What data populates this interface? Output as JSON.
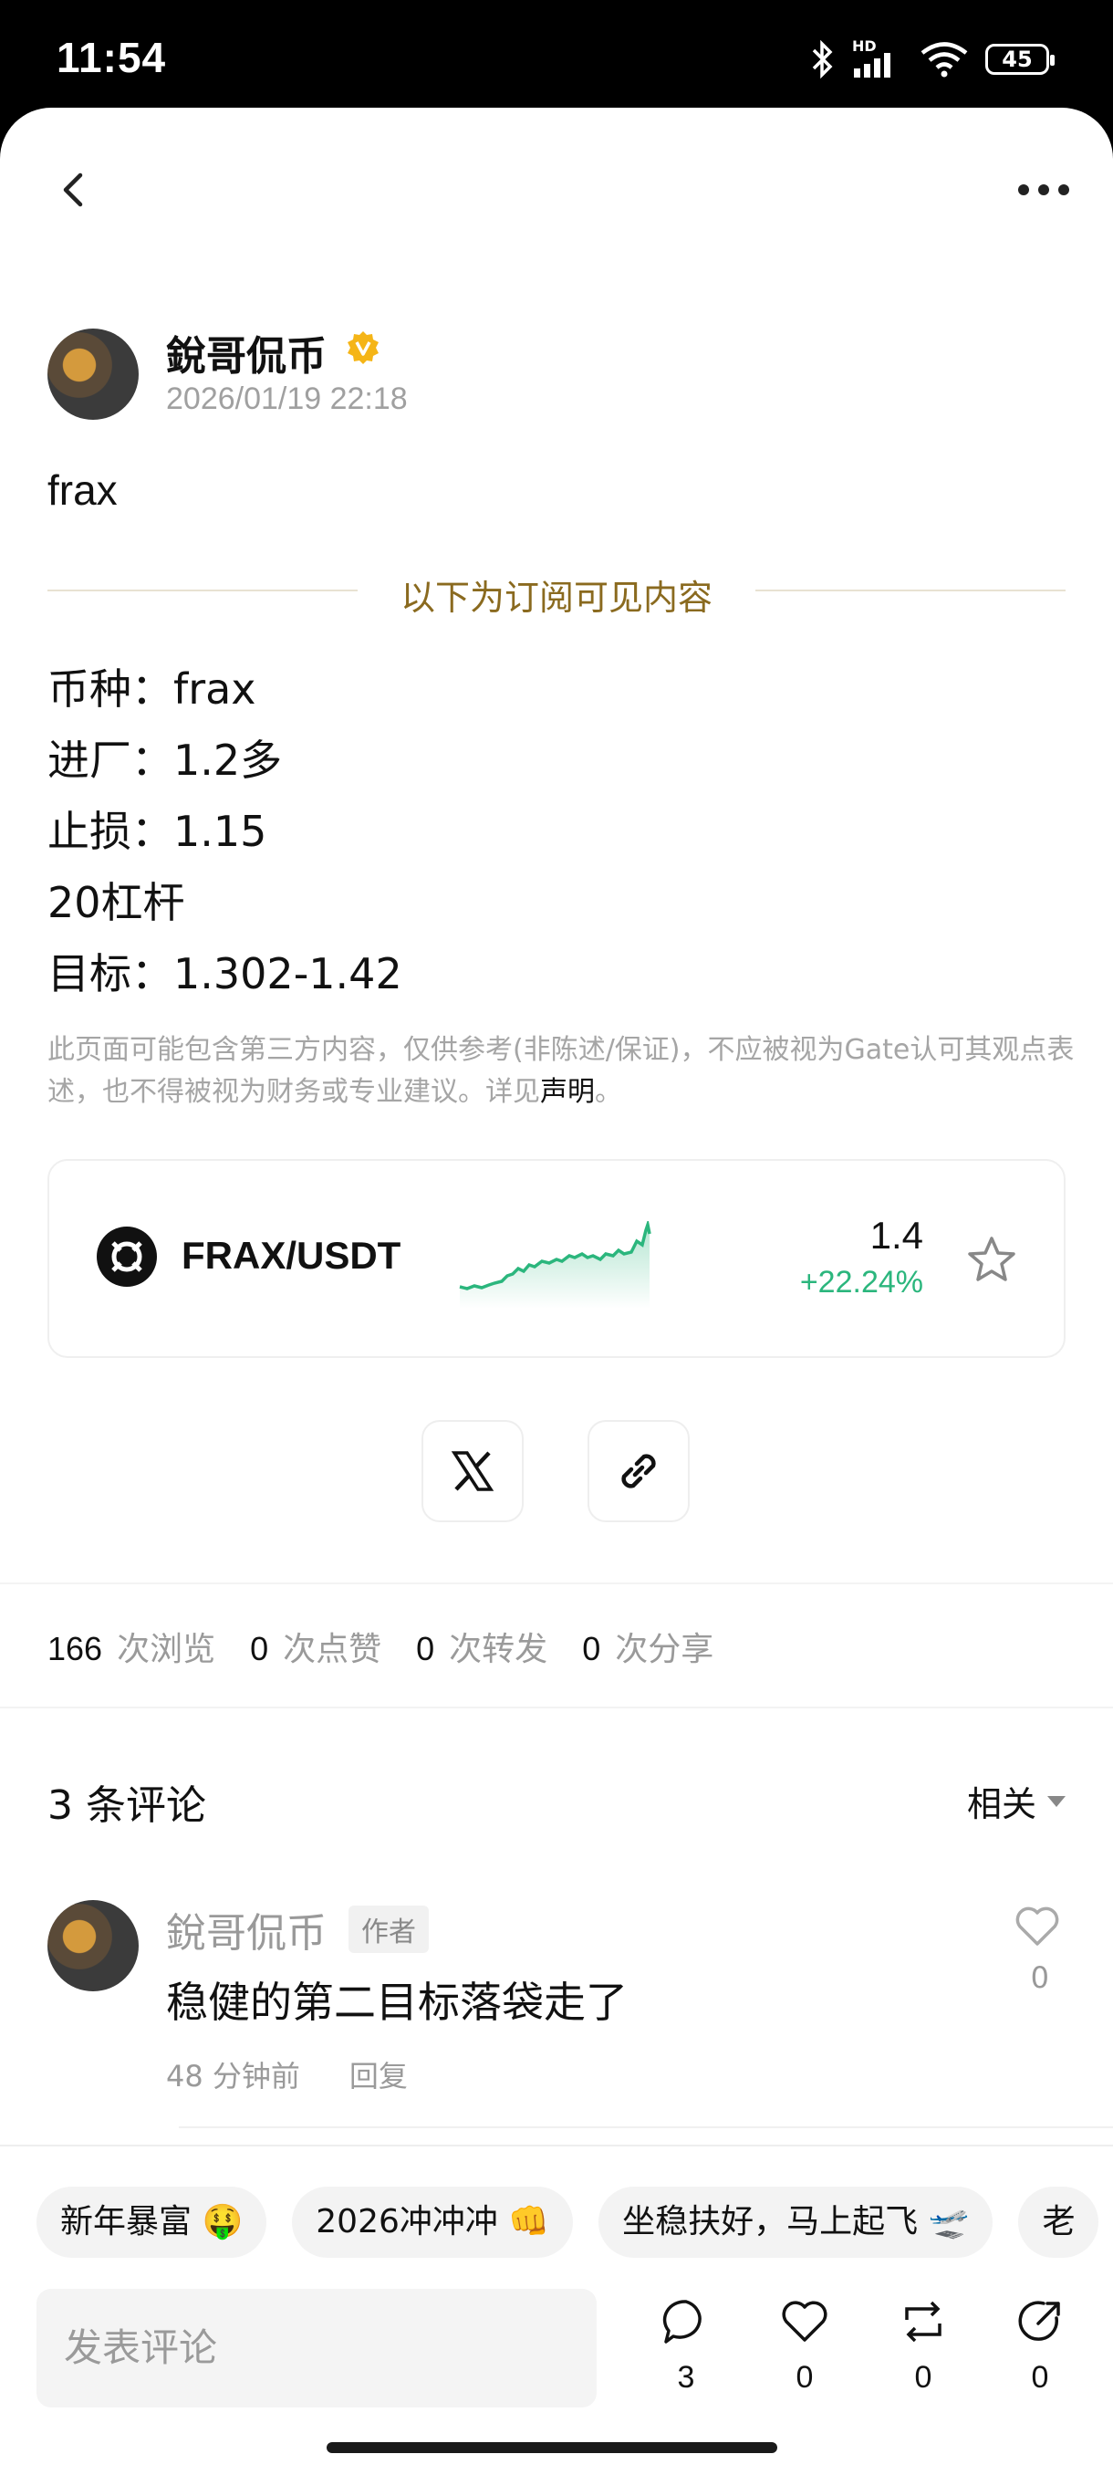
{
  "status_bar": {
    "time": "11:54",
    "network": "HD",
    "battery": "45"
  },
  "post": {
    "author": "銳哥侃币",
    "date": "2026/01/19 22:18",
    "title": "frax",
    "subscription_note": "以下为订阅可见内容",
    "signal_lines": [
      "币种：frax",
      "进厂：1.2多",
      "止损：1.15",
      "20杠杆",
      "目标：1.302-1.42"
    ],
    "disclaimer_text": "此页面可能包含第三方内容，仅供参考(非陈述/保证)，不应被视为Gate认可其观点表述，也不得被视为财务或专业建议。详见",
    "disclaimer_link": "声明",
    "disclaimer_end": "。"
  },
  "ticker": {
    "pair": "FRAX/USDT",
    "price": "1.4",
    "change": "+22.24%",
    "accent_color": "#2bb67d"
  },
  "stats": [
    {
      "num": "166",
      "label": "次浏览"
    },
    {
      "num": "0",
      "label": "次点赞"
    },
    {
      "num": "0",
      "label": "次转发"
    },
    {
      "num": "0",
      "label": "次分享"
    }
  ],
  "comments": {
    "header": "3 条评论",
    "sort": "相关",
    "items": [
      {
        "name": "銳哥侃币",
        "tag": "作者",
        "text": "稳健的第二目标落袋走了",
        "time": "48 分钟前",
        "reply": "回复",
        "likes": "0"
      }
    ]
  },
  "quick_replies": [
    "新年暴富 🤑",
    "2026冲冲冲 👊",
    "坐稳扶好，马上起飞 🛫",
    "老"
  ],
  "bottom_bar": {
    "input_placeholder": "发表评论",
    "actions": [
      {
        "icon": "comment-icon",
        "count": "3"
      },
      {
        "icon": "heart-icon",
        "count": "0"
      },
      {
        "icon": "repost-icon",
        "count": "0"
      },
      {
        "icon": "share-icon",
        "count": "0"
      }
    ]
  }
}
